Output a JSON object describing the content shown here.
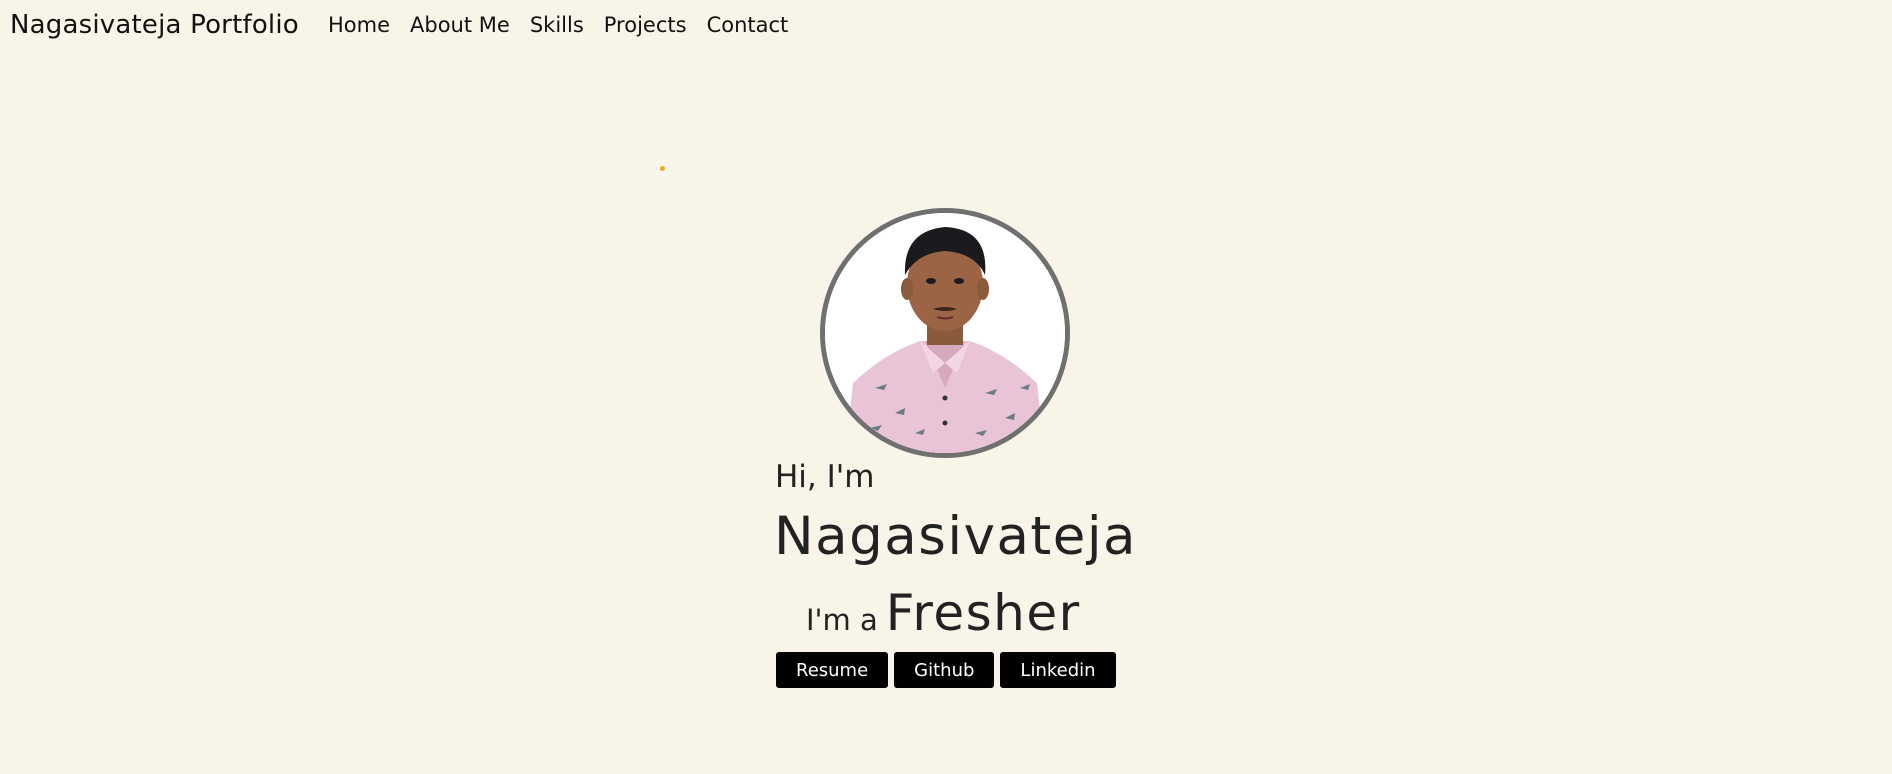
{
  "nav": {
    "brand": "Nagasivateja Portfolio",
    "links": [
      "Home",
      "About Me",
      "Skills",
      "Projects",
      "Contact"
    ]
  },
  "hero": {
    "greeting": "Hi, I'm",
    "name": "Nagasivateja",
    "role_prefix": "I'm a",
    "role": "Fresher",
    "buttons": [
      "Resume",
      "Github",
      "Linkedin"
    ]
  },
  "colors": {
    "background": "#f8f5e8",
    "button_bg": "#000000",
    "button_text": "#ffffff",
    "accent_dot": "#f5a623",
    "avatar_border": "#707070"
  }
}
